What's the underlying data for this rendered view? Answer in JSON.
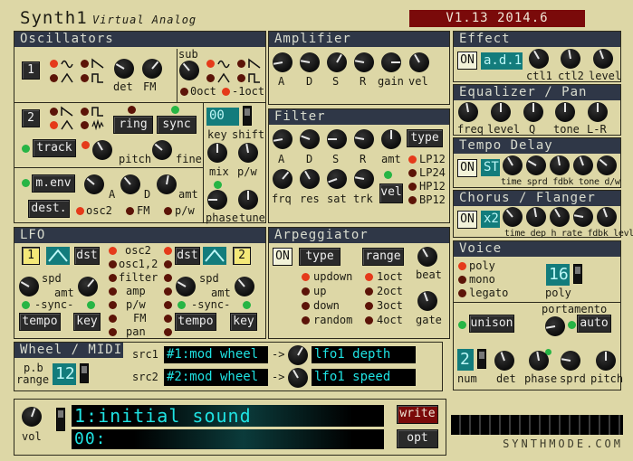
{
  "app": {
    "title": "Synth1",
    "subtitle": "Virtual Analog",
    "version": "V1.13 2014.6"
  },
  "osc": {
    "header": "Oscillators",
    "btn1": "1",
    "btn2": "2",
    "det": "det",
    "fm": "FM",
    "sub": "sub",
    "oct0": "0oct",
    "oct1": "-1oct",
    "ring": "ring",
    "sync": "sync",
    "track": "track",
    "pitch": "pitch",
    "fine": "fine",
    "key": "key",
    "shift": "shift",
    "shift_val": "00",
    "mix": "mix",
    "pw": "p/w",
    "menv": "m.env",
    "dest": "dest.",
    "a": "A",
    "d": "D",
    "amt": "amt",
    "osc2": "osc2",
    "fmd": "FM",
    "pw2": "p/w",
    "phase": "phase",
    "tune": "tune"
  },
  "amp": {
    "header": "Amplifier",
    "labels": [
      "A",
      "D",
      "S",
      "R",
      "gain",
      "vel"
    ]
  },
  "filter": {
    "header": "Filter",
    "labels": [
      "A",
      "D",
      "S",
      "R",
      "amt"
    ],
    "labels2": [
      "frq",
      "res",
      "sat",
      "trk"
    ],
    "type": "type",
    "vel": "vel",
    "types": [
      "LP12",
      "LP24",
      "HP12",
      "BP12"
    ]
  },
  "lfo": {
    "header": "LFO",
    "n1": "1",
    "n2": "2",
    "dst": "dst",
    "spd": "spd",
    "amt": "amt",
    "sync": "-sync-",
    "tempo": "tempo",
    "key": "key",
    "dests": [
      "osc2",
      "osc1,2",
      "filter",
      "amp",
      "p/w",
      "FM",
      "pan"
    ]
  },
  "arp": {
    "header": "Arpeggiator",
    "on": "ON",
    "type": "type",
    "range": "range",
    "modes": [
      "updown",
      "up",
      "down",
      "random"
    ],
    "ranges": [
      "1oct",
      "2oct",
      "3oct",
      "4oct"
    ],
    "beat": "beat",
    "gate": "gate"
  },
  "effect": {
    "header": "Effect",
    "on": "ON",
    "name": "a.d.1",
    "labels": [
      "ctl1",
      "ctl2",
      "level"
    ]
  },
  "eq": {
    "header": "Equalizer / Pan",
    "labels": [
      "freq",
      "level",
      "Q",
      "tone",
      "L-R"
    ]
  },
  "delay": {
    "header": "Tempo Delay",
    "on": "ON",
    "st": "ST",
    "labels": "time sprd fdbk tone d/w"
  },
  "chorus": {
    "header": "Chorus / Flanger",
    "on": "ON",
    "x2": "x2",
    "labels": "time dep h rate fdbk levl"
  },
  "voice": {
    "header": "Voice",
    "modes": [
      "poly",
      "mono",
      "legato"
    ],
    "poly_val": "16",
    "poly": "poly",
    "portamento": "portamento",
    "unison": "unison",
    "auto": "auto",
    "num_val": "2",
    "num": "num",
    "det": "det",
    "phase": "phase",
    "sprd": "sprd",
    "pitch": "pitch"
  },
  "wheel": {
    "header": "Wheel / MIDI",
    "pb": "p.b",
    "range": "range",
    "pb_val": "12",
    "src1": "src1",
    "src2": "src2",
    "src1_val": "#1:mod wheel",
    "src2_val": "#2:mod wheel",
    "arrow": "->",
    "dst1": "lfo1 depth",
    "dst2": "lfo1 speed"
  },
  "bottom": {
    "vol": "vol",
    "patch": "1:initial sound",
    "bank": "00:",
    "write": "write",
    "opt": "opt",
    "logo": "SYNTHMODE.COM"
  }
}
